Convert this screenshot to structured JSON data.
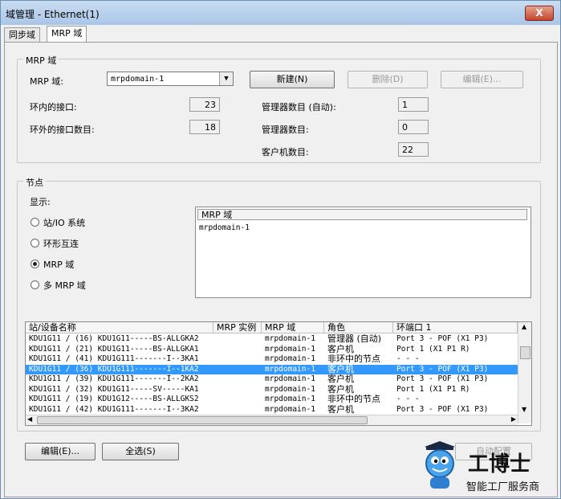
{
  "window": {
    "title": "域管理 - Ethernet(1)",
    "close_label": "X"
  },
  "tabs": [
    {
      "label": "同步域"
    },
    {
      "label": "MRP 域"
    }
  ],
  "mrp_group": {
    "title": "MRP 域",
    "domain_label": "MRP 域:",
    "domain_value": "mrpdomain-1",
    "new_button": "新建(N)",
    "delete_button": "删除(D)",
    "edit_button": "编辑(E)...",
    "ring_ports_label": "环内的接口:",
    "ring_ports_value": "23",
    "outside_ports_label": "环外的接口数目:",
    "outside_ports_value": "18",
    "managers_auto_label": "管理器数目 (自动):",
    "managers_auto_value": "1",
    "managers_label": "管理器数目:",
    "managers_value": "0",
    "clients_label": "客户机数目:",
    "clients_value": "22"
  },
  "nodes_group": {
    "title": "节点",
    "display_label": "显示:",
    "options": [
      {
        "label": "站/IO 系统",
        "checked": false
      },
      {
        "label": "环形互连",
        "checked": false
      },
      {
        "label": "MRP 域",
        "checked": true
      },
      {
        "label": "多 MRP 域",
        "checked": false
      }
    ],
    "list_header": "MRP 域",
    "list_items": [
      "mrpdomain-1"
    ]
  },
  "table": {
    "columns": [
      "站/设备名称",
      "MRP 实例",
      "MRP 域",
      "角色",
      "环端口 1"
    ],
    "rows": [
      {
        "name": "KDU1G11 / (16) KDU1G11-----BS-ALLGKA2",
        "instance": "",
        "domain": "mrpdomain-1",
        "role": "管理器 (自动)",
        "port": "Port 3 - POF (X1 P3)",
        "selected": false
      },
      {
        "name": "KDU1G11 / (21) KDU1G11-----BS-ALLGKA1",
        "instance": "",
        "domain": "mrpdomain-1",
        "role": "客户机",
        "port": "Port 1 (X1 P1 R)",
        "selected": false
      },
      {
        "name": "KDU1G11 / (41) KDU1G111-------I--3KA1",
        "instance": "",
        "domain": "mrpdomain-1",
        "role": "非环中的节点",
        "port": "- - -",
        "selected": false
      },
      {
        "name": "KDU1G11 / (36) KDU1G111-------I--1KA2",
        "instance": "",
        "domain": "mrpdomain-1",
        "role": "客户机",
        "port": "Port 3 - POF (X1 P3)",
        "selected": true
      },
      {
        "name": "KDU1G11 / (39) KDU1G111-------I--2KA2",
        "instance": "",
        "domain": "mrpdomain-1",
        "role": "客户机",
        "port": "Port 3 - POF (X1 P3)",
        "selected": false
      },
      {
        "name": "KDU1G11 / (32) KDU1G11-----SV-----KA1",
        "instance": "",
        "domain": "mrpdomain-1",
        "role": "客户机",
        "port": "Port 1 (X1 P1 R)",
        "selected": false
      },
      {
        "name": "KDU1G11 / (19) KDU1G12-----BS-ALLGKS2",
        "instance": "",
        "domain": "mrpdomain-1",
        "role": "非环中的节点",
        "port": "- - -",
        "selected": false
      },
      {
        "name": "KDU1G11 / (42) KDU1G111-------I--3KA2",
        "instance": "",
        "domain": "mrpdomain-1",
        "role": "客户机",
        "port": "Port 3 - POF (X1 P3)",
        "selected": false
      }
    ]
  },
  "footer": {
    "edit_button": "编辑(E)...",
    "select_all_button": "全选(S)",
    "auto_config_button": "自动配置"
  },
  "watermark": {
    "brand": "工博士",
    "slogan": "智能工厂服务商"
  },
  "colors": {
    "selection": "#3399ff",
    "titlebar": "#b8d1ec",
    "close": "#c2452d",
    "logo_blue": "#2f7fd0"
  }
}
